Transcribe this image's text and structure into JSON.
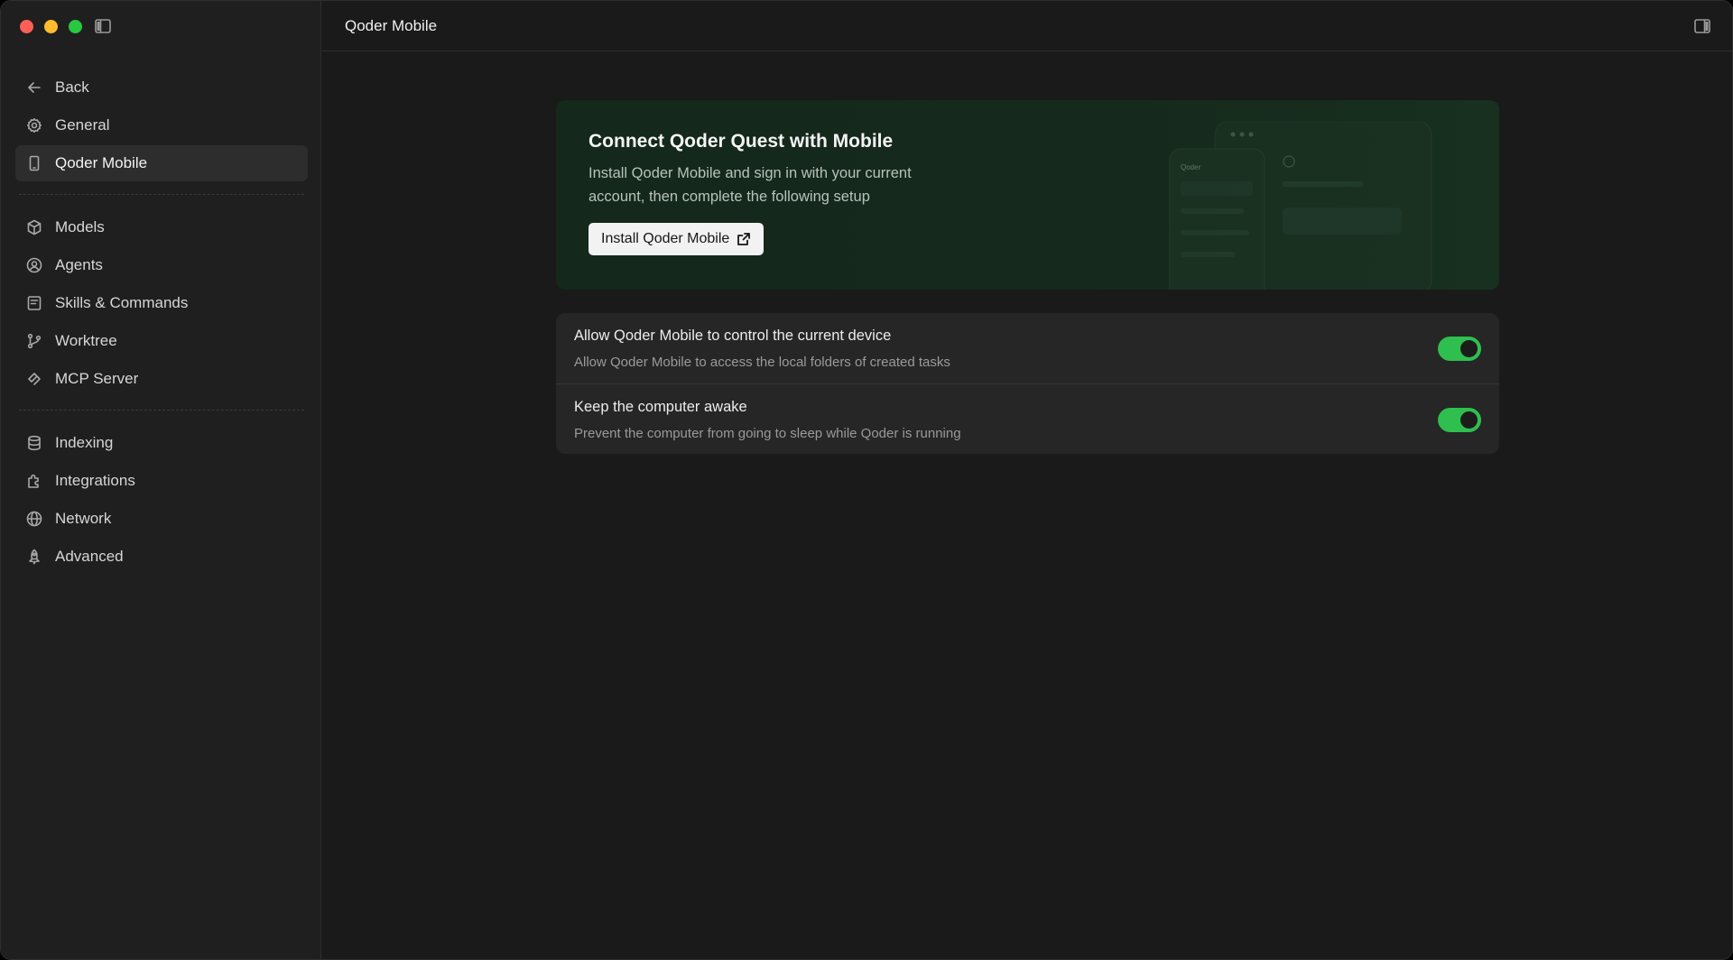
{
  "window": {
    "traffic_lights": [
      "close",
      "minimize",
      "zoom"
    ]
  },
  "sidebar": {
    "back_label": "Back",
    "groups": [
      [
        {
          "label": "General",
          "icon": "gear-icon"
        },
        {
          "label": "Qoder Mobile",
          "icon": "phone-icon",
          "active": true
        }
      ],
      [
        {
          "label": "Models",
          "icon": "cube-icon"
        },
        {
          "label": "Agents",
          "icon": "user-circle-icon"
        },
        {
          "label": "Skills & Commands",
          "icon": "book-icon"
        },
        {
          "label": "Worktree",
          "icon": "branch-icon"
        },
        {
          "label": "MCP Server",
          "icon": "plug-icon"
        }
      ],
      [
        {
          "label": "Indexing",
          "icon": "database-icon"
        },
        {
          "label": "Integrations",
          "icon": "puzzle-icon"
        },
        {
          "label": "Network",
          "icon": "globe-icon"
        },
        {
          "label": "Advanced",
          "icon": "rocket-icon"
        }
      ]
    ]
  },
  "header": {
    "title": "Qoder Mobile"
  },
  "hero": {
    "title": "Connect Qoder Quest with Mobile",
    "description": "Install Qoder Mobile and sign in with your current account, then complete the following setup",
    "install_label": "Install Qoder Mobile",
    "illustration_label": "Qoder"
  },
  "settings": [
    {
      "title": "Allow Qoder Mobile to control the current device",
      "description": "Allow Qoder Mobile to access the local folders of created tasks",
      "enabled": true
    },
    {
      "title": "Keep the computer awake",
      "description": "Prevent the computer from going to sleep while Qoder is running",
      "enabled": true
    }
  ],
  "colors": {
    "toggle_on": "#2fbf4f",
    "hero_bg": "#15291c",
    "accent_red": "#fe5f57",
    "accent_yellow": "#febc2e",
    "accent_green": "#28c840"
  }
}
